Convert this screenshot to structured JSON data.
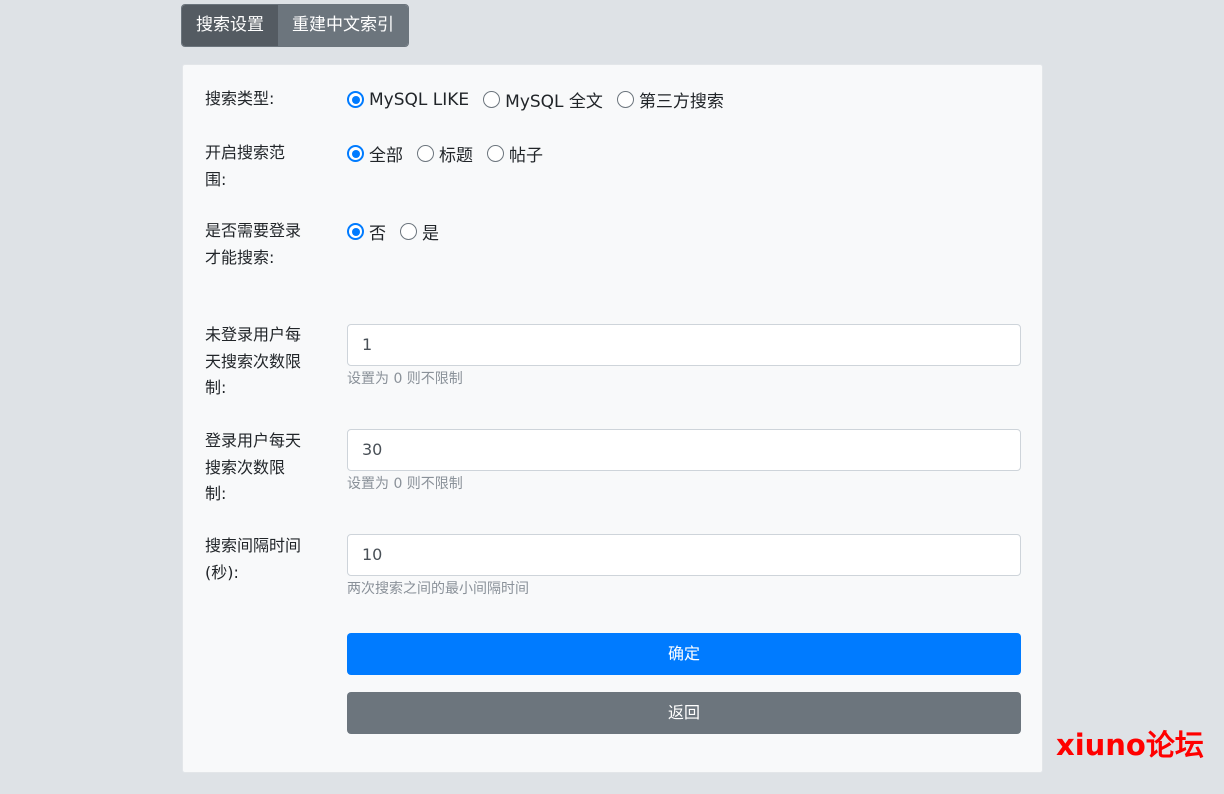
{
  "tabs": [
    {
      "label": "搜索设置",
      "active": true
    },
    {
      "label": "重建中文索引",
      "active": false
    }
  ],
  "form": {
    "search_type": {
      "label": "搜索类型:",
      "options": [
        "MySQL LIKE",
        "MySQL 全文",
        "第三方搜索"
      ],
      "selected": "MySQL LIKE"
    },
    "search_scope": {
      "label": "开启搜索范围:",
      "options": [
        "全部",
        "标题",
        "帖子"
      ],
      "selected": "全部"
    },
    "require_login": {
      "label": "是否需要登录才能搜索:",
      "options": [
        "否",
        "是"
      ],
      "selected": "否"
    },
    "guest_limit": {
      "label": "未登录用户每天搜索次数限制:",
      "value": "1",
      "hint": "设置为 0 则不限制"
    },
    "user_limit": {
      "label": "登录用户每天搜索次数限制:",
      "value": "30",
      "hint": "设置为 0 则不限制"
    },
    "interval": {
      "label": "搜索间隔时间(秒):",
      "value": "10",
      "hint": "两次搜索之间的最小间隔时间"
    }
  },
  "buttons": {
    "confirm_label": "确定",
    "back_label": "返回"
  },
  "watermark": "xiuno论坛",
  "colors": {
    "primary": "#007bff",
    "secondary": "#6c757d",
    "watermark": "#ff0000"
  }
}
